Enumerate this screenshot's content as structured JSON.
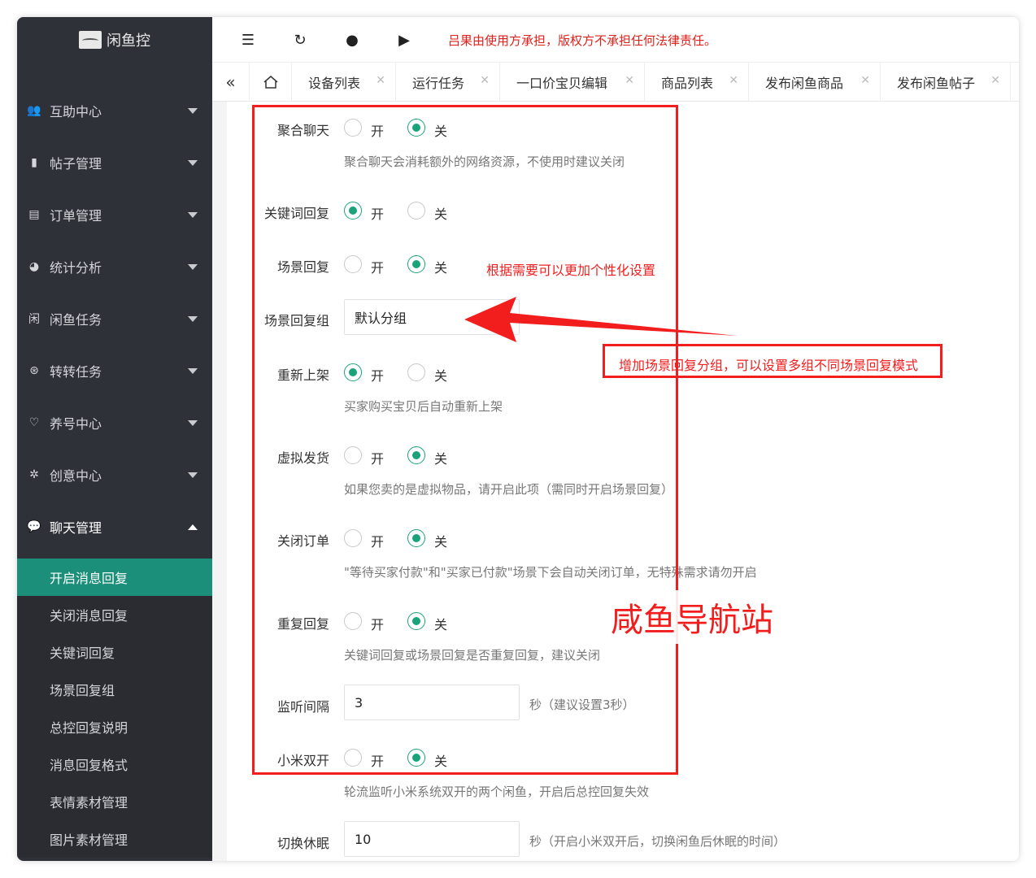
{
  "logo": {
    "text": "闲鱼控"
  },
  "sidebar": {
    "items": [
      {
        "label": "互助中心"
      },
      {
        "label": "帖子管理"
      },
      {
        "label": "订单管理"
      },
      {
        "label": "统计分析"
      },
      {
        "label": "闲鱼任务"
      },
      {
        "label": "转转任务"
      },
      {
        "label": "养号中心"
      },
      {
        "label": "创意中心"
      },
      {
        "label": "聊天管理"
      }
    ],
    "subitems": [
      {
        "label": "开启消息回复"
      },
      {
        "label": "关闭消息回复"
      },
      {
        "label": "关键词回复"
      },
      {
        "label": "场景回复组"
      },
      {
        "label": "总控回复说明"
      },
      {
        "label": "消息回复格式"
      },
      {
        "label": "表情素材管理"
      },
      {
        "label": "图片素材管理"
      }
    ]
  },
  "topbar": {
    "notice": "吕果由使用方承担，版权方不承担任何法律责任。"
  },
  "tabs": [
    {
      "label": "设备列表"
    },
    {
      "label": "运行任务"
    },
    {
      "label": "一口价宝贝编辑"
    },
    {
      "label": "商品列表"
    },
    {
      "label": "发布闲鱼商品"
    },
    {
      "label": "发布闲鱼帖子"
    }
  ],
  "radio_labels": {
    "on": "开",
    "off": "关"
  },
  "form": {
    "agg_chat": {
      "label": "聚合聊天",
      "value": "off",
      "hint": "聚合聊天会消耗额外的网络资源，不使用时建议关闭"
    },
    "keyword_reply": {
      "label": "关键词回复",
      "value": "on"
    },
    "scene_reply": {
      "label": "场景回复",
      "value": "off"
    },
    "scene_group": {
      "label": "场景回复组",
      "value": "默认分组"
    },
    "relist": {
      "label": "重新上架",
      "value": "on",
      "hint": "买家购买宝贝后自动重新上架"
    },
    "virtual_ship": {
      "label": "虚拟发货",
      "value": "off",
      "hint": "如果您卖的是虚拟物品，请开启此项（需同时开启场景回复）"
    },
    "close_order": {
      "label": "关闭订单",
      "value": "off",
      "hint": "\"等待买家付款\"和\"买家已付款\"场景下会自动关闭订单，无特殊需求请勿开启"
    },
    "repeat_reply": {
      "label": "重复回复",
      "value": "off",
      "hint": "关键词回复或场景回复是否重复回复，建议关闭"
    },
    "listen_interval": {
      "label": "监听间隔",
      "value": "3",
      "hint": "秒（建议设置3秒）"
    },
    "xiaomi_dual": {
      "label": "小米双开",
      "value": "off",
      "hint": "轮流监听小米系统双开的两个闲鱼，开启后总控回复失效"
    },
    "switch_sleep": {
      "label": "切换休眠",
      "value": "10",
      "hint": "秒（开启小米双开后，切换闲鱼后休眠的时间）"
    }
  },
  "annotations": {
    "note1": "根据需要可以更加个性化设置",
    "note2": "增加场景回复分组，可以设置多组不同场景回复模式",
    "watermark": "咸鱼导航站"
  },
  "colors": {
    "sidebar_bg": "#2e3138",
    "active_teal": "#1b8f7a",
    "radio_green": "#1aa37a",
    "annotation_red": "#f21e1e"
  }
}
